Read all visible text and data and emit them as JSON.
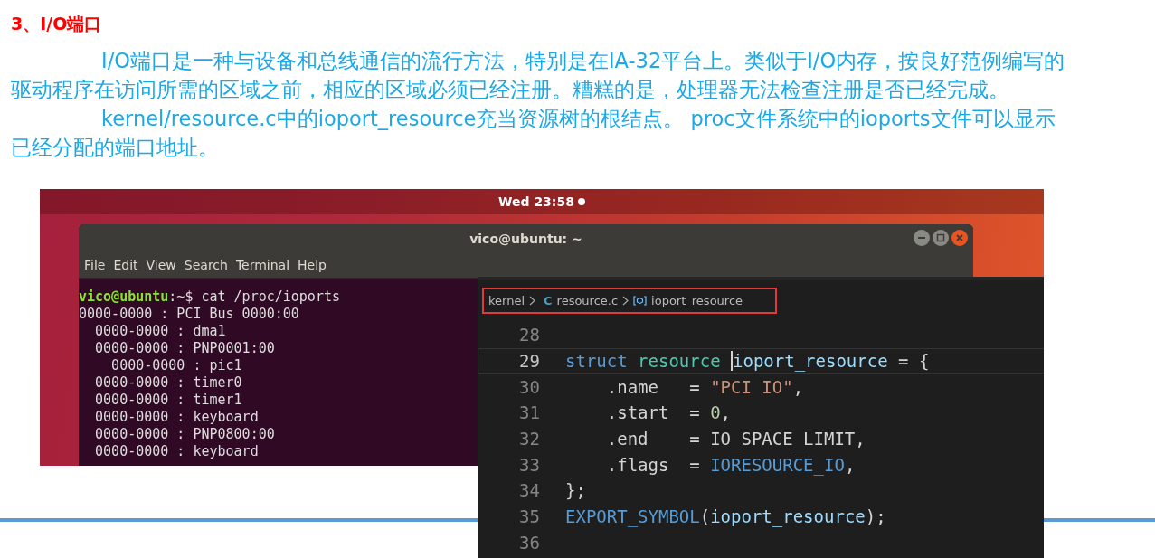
{
  "heading": "3、I/O端口",
  "paragraphs": [
    "I/O端口是一种与设备和总线通信的流行方法，特别是在IA-32平台上。类似于I/O内存，按良好范例编写的驱动程序在访问所需的区域之前，相应的区域必须已经注册。糟糕的是，处理器无法检查注册是否已经完成。",
    "kernel/resource.c中的ioport_resource充当资源树的根结点。 proc文件系统中的ioports文件可以显示已经分配的端口地址。"
  ],
  "desktop": {
    "clock": "Wed 23:58"
  },
  "terminal": {
    "title": "vico@ubuntu: ~",
    "menu": [
      "File",
      "Edit",
      "View",
      "Search",
      "Terminal",
      "Help"
    ],
    "prompt": {
      "user": "vico@ubuntu",
      "rest": ":~$ cat /proc/ioports"
    },
    "entries": [
      {
        "text": "0000-0000 : PCI Bus 0000:00",
        "children": [
          {
            "text": "0000-0000 : dma1"
          },
          {
            "text": "0000-0000 : PNP0001:00",
            "children": [
              {
                "text": "0000-0000 : pic1"
              }
            ]
          },
          {
            "text": "0000-0000 : timer0"
          },
          {
            "text": "0000-0000 : timer1"
          },
          {
            "text": "0000-0000 : keyboard"
          },
          {
            "text": "0000-0000 : PNP0800:00"
          },
          {
            "text": "0000-0000 : keyboard"
          }
        ]
      }
    ]
  },
  "editor": {
    "breadcrumb": [
      {
        "kind": "folder",
        "label": "kernel"
      },
      {
        "kind": "file",
        "icon": "C",
        "label": "resource.c"
      },
      {
        "kind": "symbol",
        "label": "ioport_resource"
      }
    ],
    "lines": [
      {
        "number": "28",
        "current": false
      },
      {
        "number": "29",
        "current": true,
        "tokens": [
          {
            "kind": "keyword",
            "text": "struct "
          },
          {
            "kind": "type",
            "text": "resource "
          },
          {
            "kind": "cursor"
          },
          {
            "kind": "var",
            "text": "ioport_resource"
          },
          {
            "kind": "plain",
            "text": " = {"
          }
        ]
      },
      {
        "number": "30",
        "current": false,
        "tokens": [
          {
            "kind": "plain",
            "text": "    .name   = "
          },
          {
            "kind": "string",
            "text": "\"PCI IO\""
          },
          {
            "kind": "plain",
            "text": ","
          }
        ]
      },
      {
        "number": "31",
        "current": false,
        "tokens": [
          {
            "kind": "plain",
            "text": "    .start  = "
          },
          {
            "kind": "number",
            "text": "0"
          },
          {
            "kind": "plain",
            "text": ","
          }
        ]
      },
      {
        "number": "32",
        "current": false,
        "tokens": [
          {
            "kind": "plain",
            "text": "    .end    = IO_SPACE_LIMIT,"
          }
        ]
      },
      {
        "number": "33",
        "current": false,
        "tokens": [
          {
            "kind": "plain",
            "text": "    .flags  = "
          },
          {
            "kind": "keyword",
            "text": "IORESOURCE_IO"
          },
          {
            "kind": "plain",
            "text": ","
          }
        ]
      },
      {
        "number": "34",
        "current": false,
        "tokens": [
          {
            "kind": "plain",
            "text": "};"
          }
        ]
      },
      {
        "number": "35",
        "current": false,
        "tokens": [
          {
            "kind": "keyword",
            "text": "EXPORT_SYMBOL"
          },
          {
            "kind": "plain",
            "text": "("
          },
          {
            "kind": "var",
            "text": "ioport_resource"
          },
          {
            "kind": "plain",
            "text": ");"
          }
        ]
      },
      {
        "number": "36",
        "current": false
      }
    ]
  }
}
